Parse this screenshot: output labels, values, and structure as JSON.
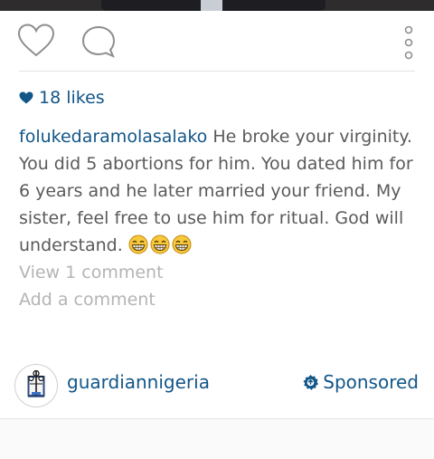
{
  "actions": {
    "like_icon": "heart-outline-icon",
    "comment_icon": "comment-bubble-icon",
    "more_icon": "vertical-dots-icon"
  },
  "likes": {
    "icon": "heart-filled-icon",
    "text": "18 likes"
  },
  "caption": {
    "username": "folukedaramolasalako",
    "text": " He broke your virginity. You did 5 abortions for him. You dated him for 6 years and he later married your friend. My sister, feel free to use him for ritual. God will understand. ",
    "emojis": [
      "grinning-face-emoji",
      "grinning-face-emoji",
      "grinning-face-emoji"
    ]
  },
  "comments": {
    "view_text": "View 1 comment",
    "add_placeholder": "Add a comment"
  },
  "footer": {
    "account_name": "guardiannigeria",
    "sponsored_label": "Sponsored",
    "sponsored_icon": "gear-badge-icon"
  },
  "colors": {
    "link_blue": "#125688",
    "text_gray": "#5a5a5a",
    "muted_gray": "#b4b4b4"
  }
}
